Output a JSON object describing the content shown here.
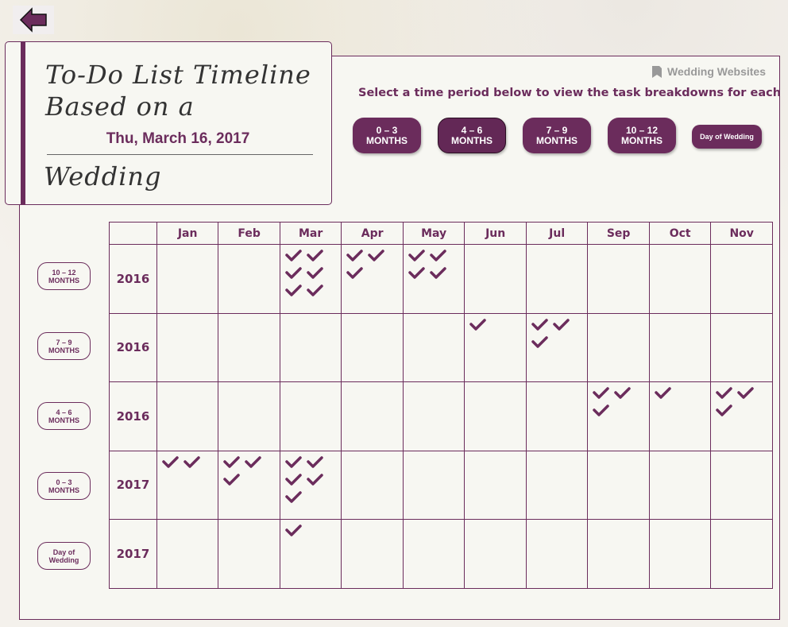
{
  "back_icon": "arrow-left-icon",
  "title": {
    "line1": "To-Do List Timeline",
    "line2": "Based on a",
    "line3": "Wedding",
    "date": "Thu, March 16, 2017"
  },
  "wedding_websites": {
    "label": "Wedding Websites",
    "icon": "bookmark-icon"
  },
  "instruction": "Select a time period below to view the task breakdowns for each",
  "period_buttons": [
    {
      "line1": "0 – 3",
      "line2": "MONTHS"
    },
    {
      "line1": "4 – 6",
      "line2": "MONTHS",
      "selected": true
    },
    {
      "line1": "7 – 9",
      "line2": "MONTHS"
    },
    {
      "line1": "10 – 12",
      "line2": "MONTHS"
    },
    {
      "line1": "Day of Wedding",
      "line2": ""
    }
  ],
  "accent_color": "#6b2c5c",
  "table": {
    "months": [
      "Jan",
      "Feb",
      "Mar",
      "Apr",
      "May",
      "Jun",
      "Jul",
      "Sep",
      "Oct",
      "Nov"
    ],
    "rows": [
      {
        "label1": "10 – 12",
        "label2": "MONTHS",
        "year": "2016",
        "checks": [
          0,
          0,
          6,
          3,
          4,
          0,
          0,
          0,
          0,
          0
        ]
      },
      {
        "label1": "7 – 9",
        "label2": "MONTHS",
        "year": "2016",
        "checks": [
          0,
          0,
          0,
          0,
          0,
          1,
          3,
          0,
          0,
          0
        ]
      },
      {
        "label1": "4 – 6",
        "label2": "MONTHS",
        "year": "2016",
        "checks": [
          0,
          0,
          0,
          0,
          0,
          0,
          0,
          3,
          1,
          3
        ]
      },
      {
        "label1": "0 – 3",
        "label2": "MONTHS",
        "year": "2017",
        "checks": [
          2,
          3,
          5,
          0,
          0,
          0,
          0,
          0,
          0,
          0
        ]
      },
      {
        "label1": "Day of",
        "label2": "Wedding",
        "year": "2017",
        "checks": [
          0,
          0,
          1,
          0,
          0,
          0,
          0,
          0,
          0,
          0
        ]
      }
    ]
  }
}
